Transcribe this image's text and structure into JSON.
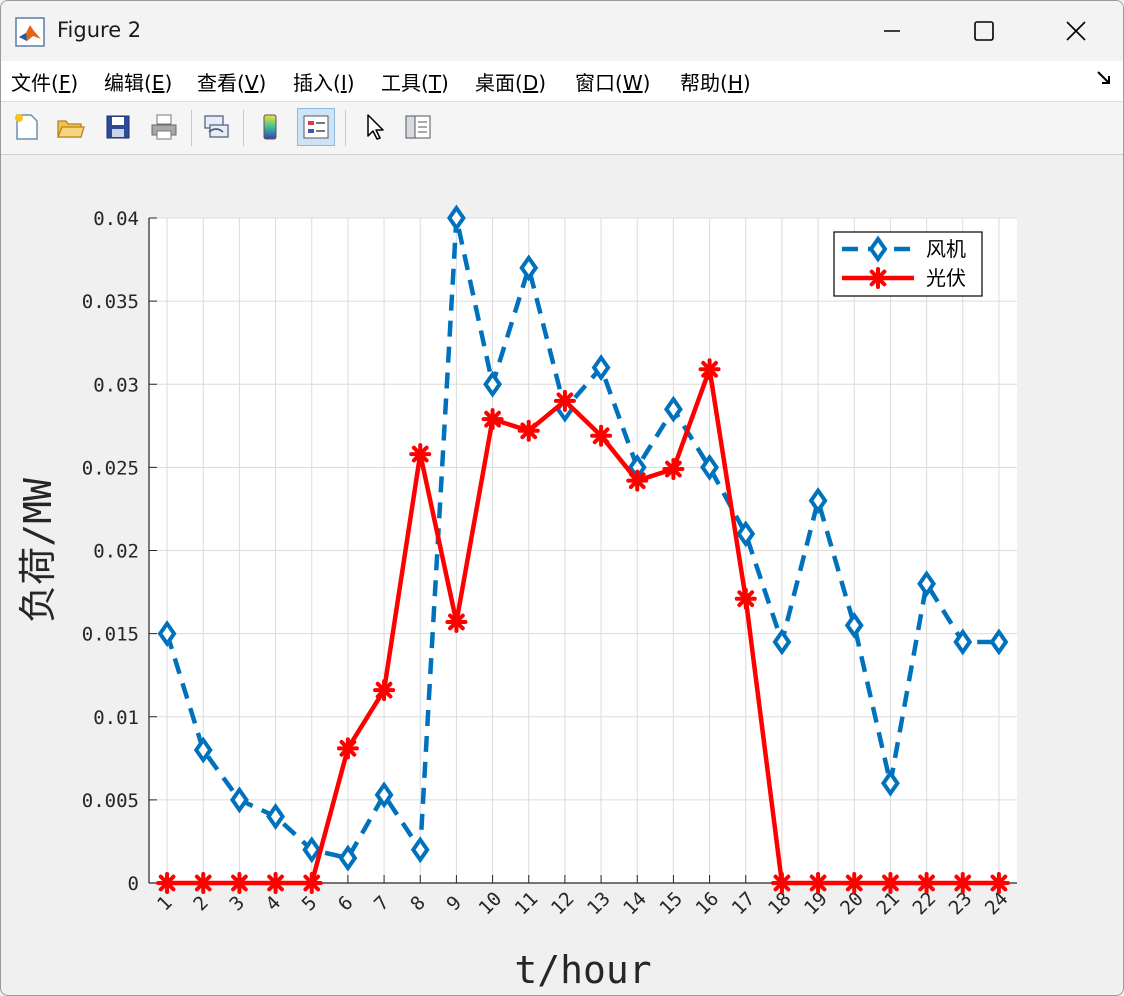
{
  "window": {
    "title": "Figure 2"
  },
  "menu": {
    "items": [
      {
        "label": "文件(",
        "key": "F",
        "tail": ")"
      },
      {
        "label": "编辑(",
        "key": "E",
        "tail": ")"
      },
      {
        "label": "查看(",
        "key": "V",
        "tail": ")"
      },
      {
        "label": "插入(",
        "key": "I",
        "tail": ")"
      },
      {
        "label": "工具(",
        "key": "T",
        "tail": ")"
      },
      {
        "label": "桌面(",
        "key": "D",
        "tail": ")"
      },
      {
        "label": "窗口(",
        "key": "W",
        "tail": ")"
      },
      {
        "label": "帮助(",
        "key": "H",
        "tail": ")"
      }
    ]
  },
  "toolbar": {
    "icons": [
      "new-figure-icon",
      "open-file-icon",
      "save-icon",
      "print-icon",
      "link-plot-icon",
      "colorbar-icon",
      "legend-icon",
      "pointer-icon",
      "property-inspector-icon"
    ]
  },
  "colors": {
    "wind": "#0072BD",
    "pv": "#FF0000",
    "grid": "#dcdcdc"
  },
  "chart_data": {
    "type": "line",
    "xlabel": "t/hour",
    "ylabel": "负荷/MW",
    "x": [
      1,
      2,
      3,
      4,
      5,
      6,
      7,
      8,
      9,
      10,
      11,
      12,
      13,
      14,
      15,
      16,
      17,
      18,
      19,
      20,
      21,
      22,
      23,
      24
    ],
    "ylim": [
      0,
      0.04
    ],
    "yticks": [
      "0",
      "0.005",
      "0.01",
      "0.015",
      "0.02",
      "0.025",
      "0.03",
      "0.035",
      "0.04"
    ],
    "grid": true,
    "legend_position": "top-right",
    "series": [
      {
        "name": "风机",
        "style": "dashed",
        "marker": "diamond",
        "values": [
          0.015,
          0.008,
          0.005,
          0.004,
          0.002,
          0.0015,
          0.0053,
          0.002,
          0.04,
          0.03,
          0.037,
          0.0285,
          0.031,
          0.025,
          0.0285,
          0.025,
          0.021,
          0.0145,
          0.023,
          0.0155,
          0.006,
          0.018,
          0.0145,
          0.0145
        ]
      },
      {
        "name": "光伏",
        "style": "solid",
        "marker": "asterisk",
        "values": [
          0,
          0,
          0,
          0,
          0,
          0.0081,
          0.0116,
          0.0258,
          0.0157,
          0.0279,
          0.0272,
          0.029,
          0.0269,
          0.0242,
          0.0249,
          0.0309,
          0.0171,
          0,
          0,
          0,
          0,
          0,
          0,
          0
        ]
      }
    ]
  }
}
